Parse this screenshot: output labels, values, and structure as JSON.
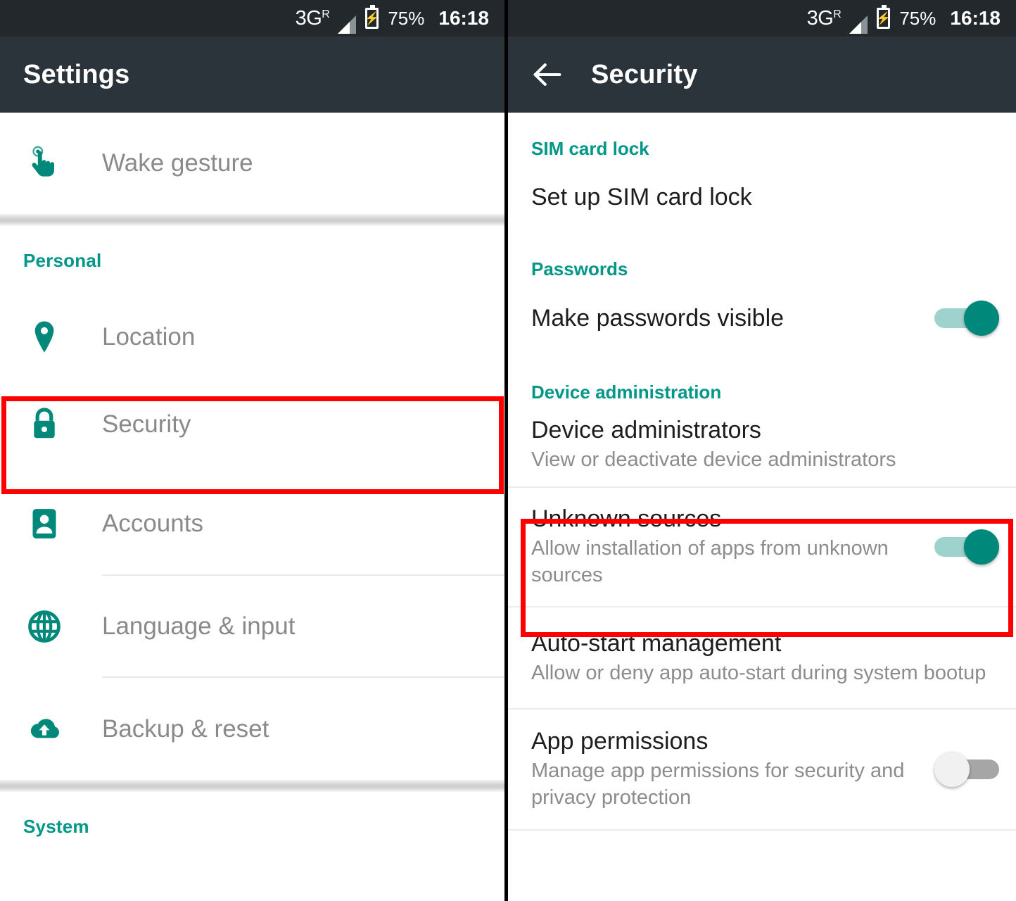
{
  "status_bar": {
    "network": "3G",
    "network_superscript": "R",
    "battery_percent": "75%",
    "time": "16:18",
    "signal_icon": "signal-bars-icon",
    "battery_icon": "battery-charging-icon"
  },
  "left_screen": {
    "title": "Settings",
    "groups": [
      {
        "header": null,
        "items": [
          {
            "icon": "tap-gesture-icon",
            "label": "Wake gesture"
          }
        ]
      },
      {
        "header": "Personal",
        "items": [
          {
            "icon": "location-pin-icon",
            "label": "Location"
          },
          {
            "icon": "lock-icon",
            "label": "Security",
            "highlighted": true
          },
          {
            "icon": "account-person-icon",
            "label": "Accounts"
          },
          {
            "icon": "globe-icon",
            "label": "Language & input"
          },
          {
            "icon": "cloud-upload-icon",
            "label": "Backup & reset"
          }
        ]
      },
      {
        "header": "System",
        "items": []
      }
    ]
  },
  "right_screen": {
    "title": "Security",
    "back_icon": "back-arrow-icon",
    "sections": [
      {
        "header": "SIM card lock",
        "items": [
          {
            "title": "Set up SIM card lock",
            "subtitle": null,
            "toggle": null
          }
        ]
      },
      {
        "header": "Passwords",
        "items": [
          {
            "title": "Make passwords visible",
            "subtitle": null,
            "toggle": "on"
          }
        ]
      },
      {
        "header": "Device administration",
        "items": [
          {
            "title": "Device administrators",
            "subtitle": "View or deactivate device administrators",
            "toggle": null
          },
          {
            "title": "Unknown sources",
            "subtitle": "Allow installation of apps from unknown sources",
            "toggle": "on",
            "highlighted": true
          },
          {
            "title": "Auto-start management",
            "subtitle": "Allow or deny app auto-start during system bootup",
            "toggle": null
          },
          {
            "title": "App permissions",
            "subtitle": "Manage app permissions for security and privacy protection",
            "toggle": "off"
          }
        ]
      }
    ]
  },
  "colors": {
    "accent_teal": "#009688",
    "appbar": "#2b343b",
    "statusbar": "#22282c",
    "highlight_red": "#ff0000",
    "switch_on_track": "#9ed2cd",
    "switch_on_knob": "#00897b",
    "switch_off_track": "#a6a6a6",
    "switch_off_knob": "#f1f1f1"
  }
}
